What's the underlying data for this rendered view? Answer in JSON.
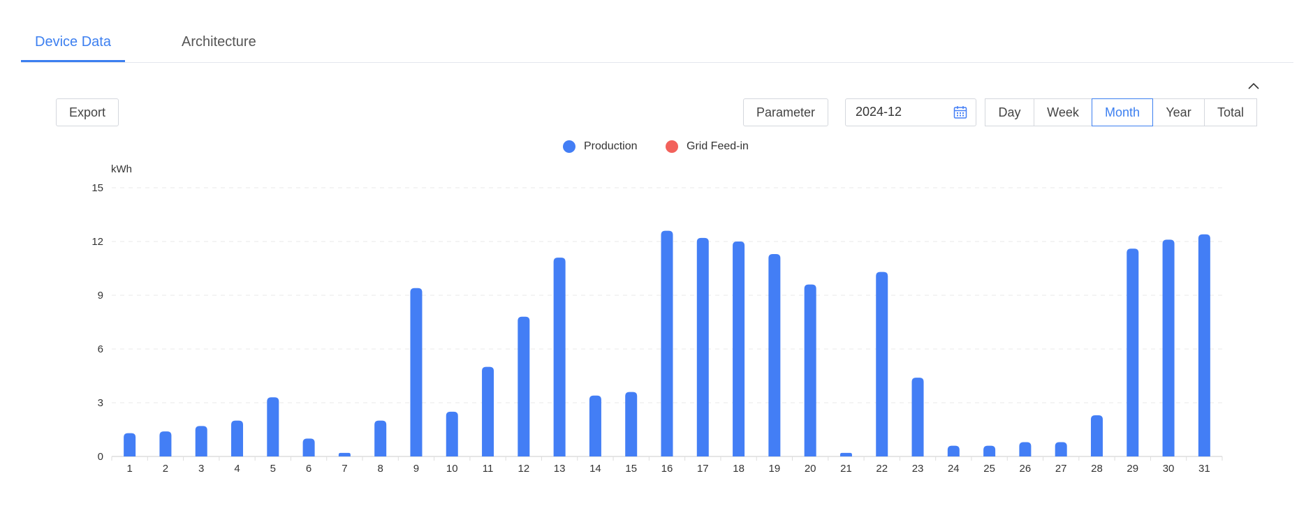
{
  "tabs": [
    {
      "label": "Device Data",
      "active": true
    },
    {
      "label": "Architecture",
      "active": false
    }
  ],
  "toolbar": {
    "export_label": "Export",
    "parameter_label": "Parameter",
    "date_value": "2024-12",
    "periods": [
      "Day",
      "Week",
      "Month",
      "Year",
      "Total"
    ],
    "active_period": "Month"
  },
  "legend": [
    {
      "name": "Production",
      "color": "#437ef5"
    },
    {
      "name": "Grid Feed-in",
      "color": "#f2615b"
    }
  ],
  "chart_data": {
    "type": "bar",
    "ylabel": "kWh",
    "ylim": [
      0,
      15
    ],
    "yticks": [
      0,
      3,
      6,
      9,
      12,
      15
    ],
    "categories": [
      "1",
      "2",
      "3",
      "4",
      "5",
      "6",
      "7",
      "8",
      "9",
      "10",
      "11",
      "12",
      "13",
      "14",
      "15",
      "16",
      "17",
      "18",
      "19",
      "20",
      "21",
      "22",
      "23",
      "24",
      "25",
      "26",
      "27",
      "28",
      "29",
      "30",
      "31"
    ],
    "series": [
      {
        "name": "Production",
        "color": "#437ef5",
        "values": [
          1.3,
          1.4,
          1.7,
          2.0,
          3.3,
          1.0,
          0.2,
          2.0,
          9.4,
          2.5,
          5.0,
          7.8,
          11.1,
          3.4,
          3.6,
          12.6,
          12.2,
          12.0,
          11.3,
          9.6,
          0.2,
          10.3,
          4.4,
          0.6,
          0.6,
          0.8,
          0.8,
          2.3,
          11.6,
          12.1,
          12.4
        ]
      },
      {
        "name": "Grid Feed-in",
        "color": "#f2615b",
        "values": []
      }
    ],
    "grid": true,
    "legend_position": "top-center"
  }
}
